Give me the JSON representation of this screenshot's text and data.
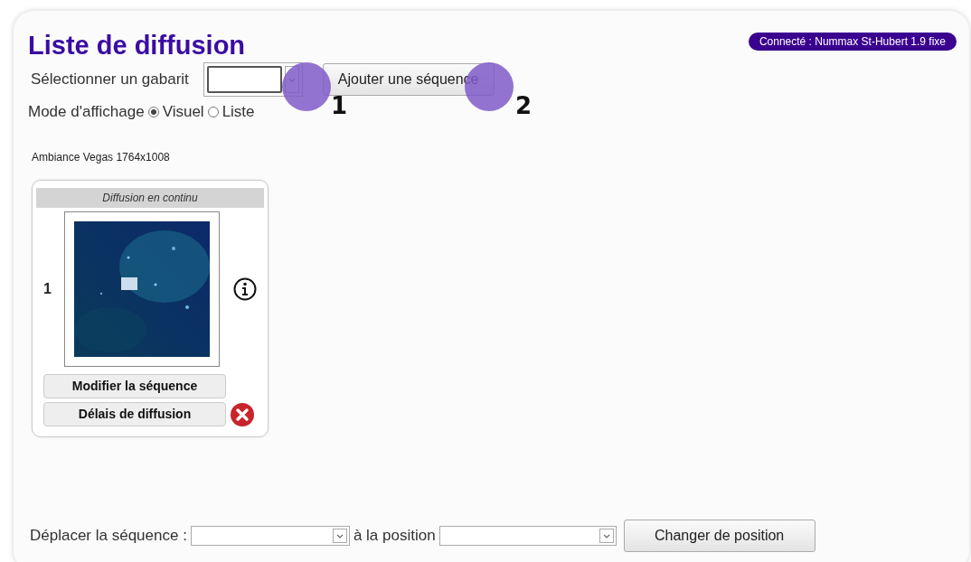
{
  "title": "Liste de diffusion",
  "connection_badge": "Connecté : Nummax St-Hubert 1.9 fixe",
  "template": {
    "label": "Sélectionner un gabarit",
    "add_button": "Ajouter une séquence"
  },
  "display_mode": {
    "label": "Mode d'affichage",
    "options": [
      {
        "label": "Visuel",
        "selected": true
      },
      {
        "label": "Liste",
        "selected": false
      }
    ]
  },
  "template_name": "Ambiance Vegas 1764x1008",
  "sequences": [
    {
      "header": "Diffusion en continu",
      "number": "1",
      "buttons": [
        "Modifier la séquence",
        "Délais de diffusion"
      ]
    }
  ],
  "move": {
    "label": "Déplacer la séquence :",
    "position_label": "à la position",
    "button": "Changer de position"
  },
  "callouts": [
    {
      "number": "1"
    },
    {
      "number": "2"
    }
  ]
}
